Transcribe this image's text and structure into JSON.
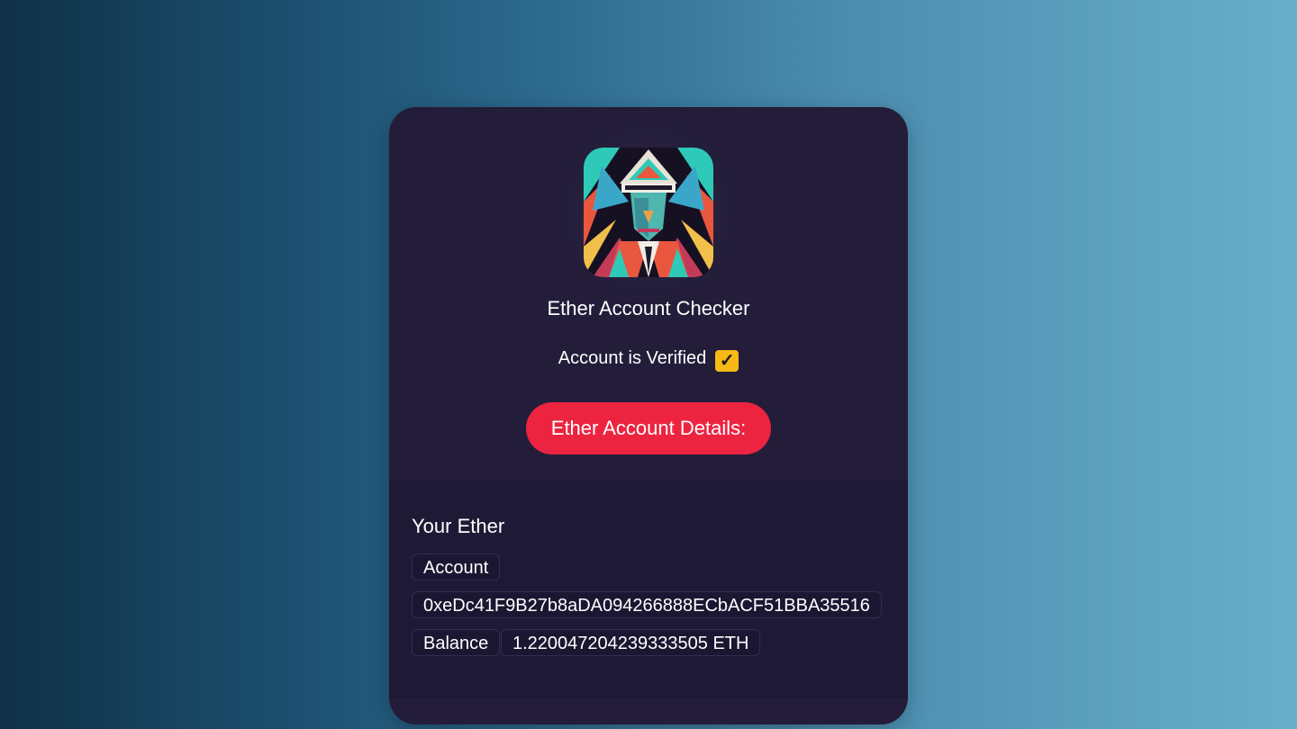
{
  "app": {
    "title": "Ether Account Checker",
    "avatar_icon": "abstract-portrait-avatar"
  },
  "status": {
    "text": "Account is Verified",
    "check_glyph": "✓",
    "check_color": "#f7b917"
  },
  "details_button": {
    "label": "Ether Account Details:",
    "color": "#ed2440"
  },
  "account_panel": {
    "heading": "Your Ether",
    "account_label": "Account",
    "address": "0xeDc41F9B27b8aDA094266888ECbACF51BBA35516",
    "balance_label": "Balance",
    "balance_value": "1.220047204239333505 ETH"
  }
}
